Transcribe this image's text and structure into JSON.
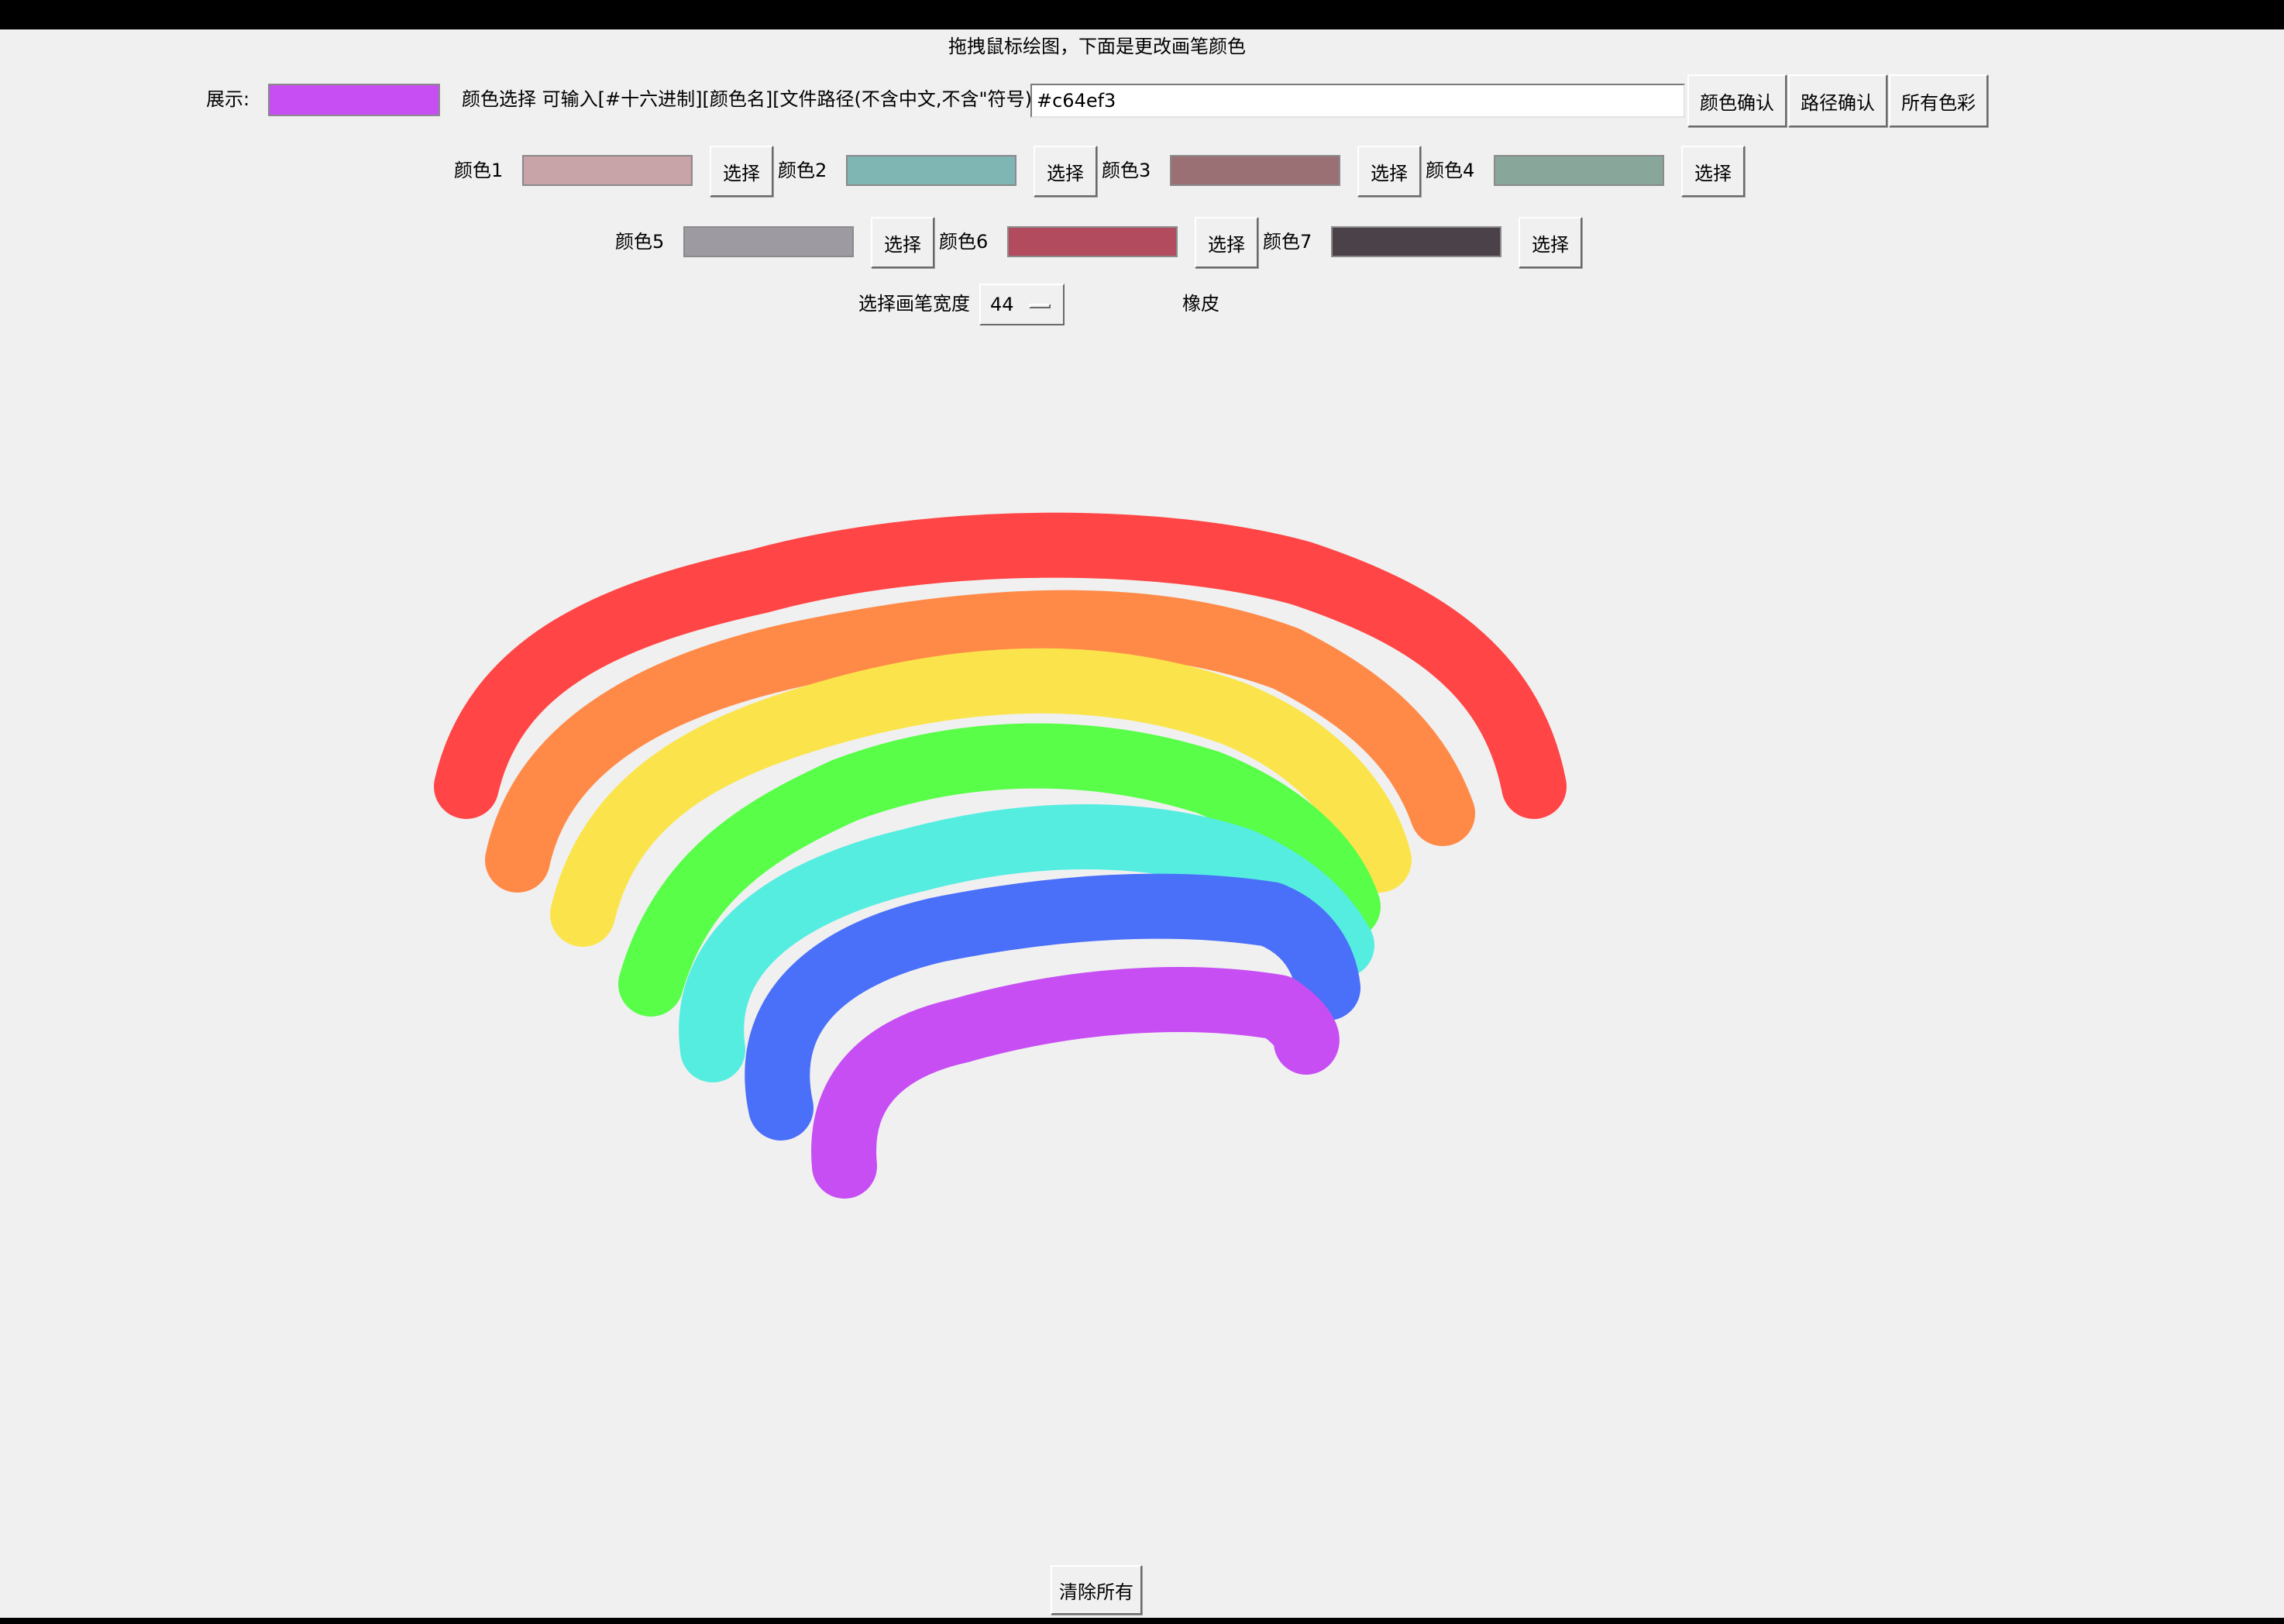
{
  "header": {
    "instruction": "拖拽鼠标绘图，下面是更改画笔颜色"
  },
  "display": {
    "label": "展示:",
    "color": "#c64ef3"
  },
  "color_input": {
    "label": "颜色选择 可输入[#十六进制][颜色名][文件路径(不含中文,不含\"符号)]",
    "value": "#c64ef3"
  },
  "buttons": {
    "confirm_color": "颜色确认",
    "confirm_path": "路径确认",
    "all_colors": "所有色彩",
    "select": "选择",
    "clear_all": "清除所有"
  },
  "palette": [
    {
      "label": "颜色1",
      "color": "#c8a3a7"
    },
    {
      "label": "颜色2",
      "color": "#7fb5b2"
    },
    {
      "label": "颜色3",
      "color": "#9b7075"
    },
    {
      "label": "颜色4",
      "color": "#88a699"
    },
    {
      "label": "颜色5",
      "color": "#9e9aa2"
    },
    {
      "label": "颜色6",
      "color": "#b34b5f"
    },
    {
      "label": "颜色7",
      "color": "#4b4148"
    }
  ],
  "brush": {
    "width_label": "选择画笔宽度",
    "width_value": "44",
    "eraser_label": "橡皮"
  },
  "canvas": {
    "strokes": [
      {
        "name": "stroke-red",
        "color": "#ff4545"
      },
      {
        "name": "stroke-orange",
        "color": "#ff8a48"
      },
      {
        "name": "stroke-yellow",
        "color": "#fbe44b"
      },
      {
        "name": "stroke-green",
        "color": "#58fe48"
      },
      {
        "name": "stroke-cyan",
        "color": "#55ede0"
      },
      {
        "name": "stroke-blue",
        "color": "#4a6ff9"
      },
      {
        "name": "stroke-purple",
        "color": "#c64ef3"
      }
    ]
  }
}
